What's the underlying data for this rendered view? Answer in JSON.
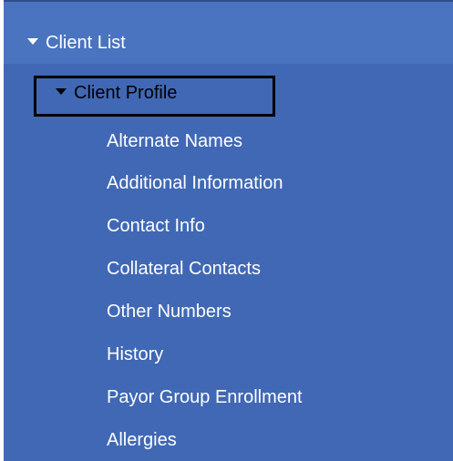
{
  "nav": {
    "client_list_label": "Client List",
    "client_profile_label": "Client Profile",
    "profile_items": [
      "Alternate Names",
      "Additional Information",
      "Contact Info",
      "Collateral Contacts",
      "Other Numbers",
      "History",
      "Payor Group Enrollment",
      "Allergies"
    ]
  },
  "colors": {
    "panel_bg": "#4068b5",
    "text": "#ffffff",
    "highlight_border": "#000000"
  },
  "icons": {
    "expand": "caret-down-icon"
  }
}
